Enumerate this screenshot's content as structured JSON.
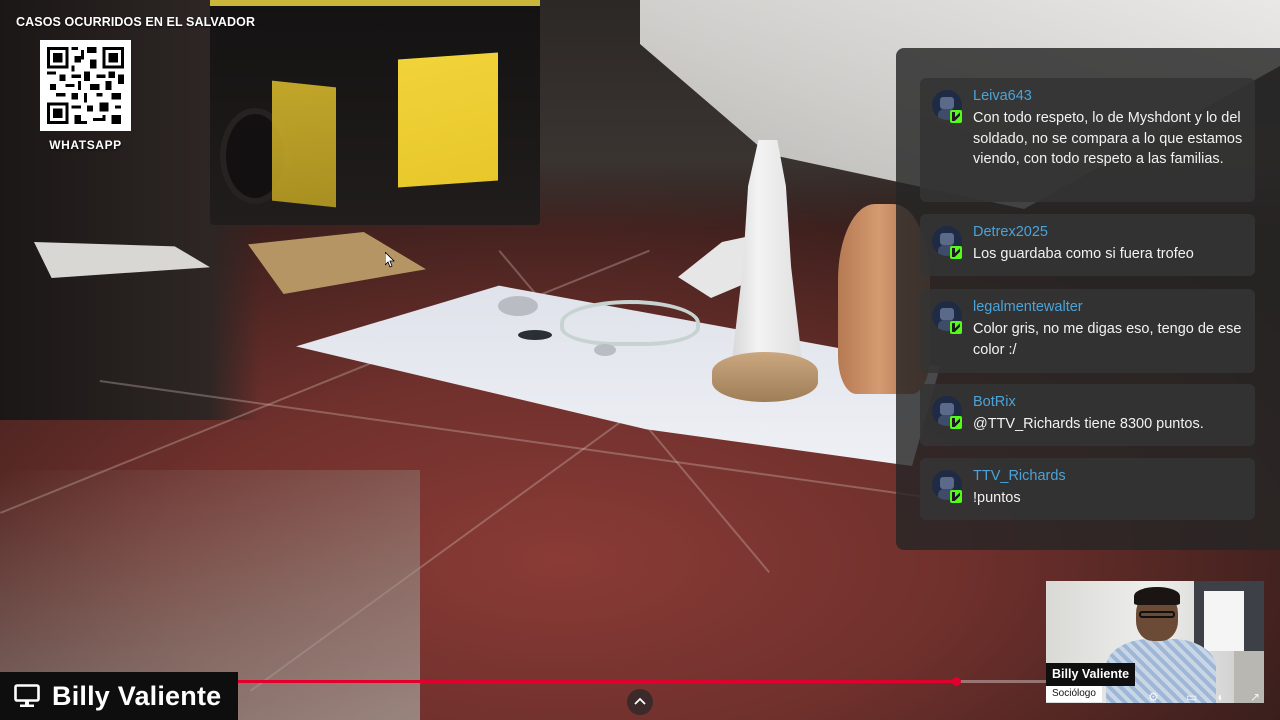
{
  "stream": {
    "channel_title": "CASOS OCURRIDOS EN EL SALVADOR",
    "qr_label": "WHATSAPP",
    "progress": 0.889
  },
  "chat": {
    "messages": [
      {
        "user": "Leiva643",
        "text": "Con todo respeto, lo de Myshdont y lo del soldado, no se compara a lo que estamos viendo, con todo respeto a las familias."
      },
      {
        "user": "Detrex2025",
        "text": "Los guardaba como si fuera trofeo"
      },
      {
        "user": "legalmentewalter",
        "text": "Color gris, no me digas eso, tengo de ese color :/"
      },
      {
        "user": "BotRix",
        "text": "@TTV_Richards tiene 8300 puntos."
      },
      {
        "user": "TTV_Richards",
        "text": "!puntos"
      }
    ],
    "username_color": "#4ba3d9",
    "badge_color": "#53fc18"
  },
  "presenter": {
    "name": "Billy Valiente",
    "icon": "monitor-icon"
  },
  "webcam": {
    "name": "Billy Valiente",
    "role": "Sociólogo"
  },
  "colors": {
    "progress": "#e1002d"
  }
}
